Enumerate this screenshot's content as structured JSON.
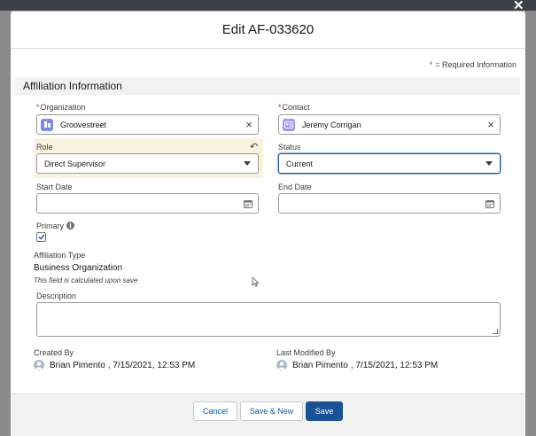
{
  "modal": {
    "title": "Edit AF-033620",
    "required_note": "= Required Information",
    "section_title": "Affiliation Information"
  },
  "fields": {
    "organization": {
      "label": "Organization",
      "value": "Groovestreet",
      "icon": "account-icon"
    },
    "contact": {
      "label": "Contact",
      "value": "Jeremy Corrigan",
      "icon": "contact-card-icon"
    },
    "role": {
      "label": "Role",
      "value": "Direct Supervisor"
    },
    "status": {
      "label": "Status",
      "value": "Current"
    },
    "start_date": {
      "label": "Start Date",
      "value": ""
    },
    "end_date": {
      "label": "End Date",
      "value": ""
    },
    "primary": {
      "label": "Primary",
      "checked": true
    },
    "affiliation_type": {
      "label": "Affiliation Type",
      "value": "Business Organization",
      "hint": "This field is calculated upon save"
    },
    "description": {
      "label": "Description",
      "value": ""
    },
    "created_by": {
      "label": "Created By",
      "user": "Brian Pimento",
      "date": ", 7/15/2021, 12:53 PM"
    },
    "last_modified_by": {
      "label": "Last Modified By",
      "user": "Brian Pimento",
      "date": ", 7/15/2021, 12:53 PM"
    }
  },
  "footer": {
    "cancel_label": "Cancel",
    "save_new_label": "Save & New",
    "save_label": "Save"
  },
  "colors": {
    "brand": "#1b5297",
    "required": "#c23934",
    "changed_field_bg": "#fbf3e0",
    "account_icon": "#7f8de1",
    "contact_icon": "#a094ed"
  }
}
